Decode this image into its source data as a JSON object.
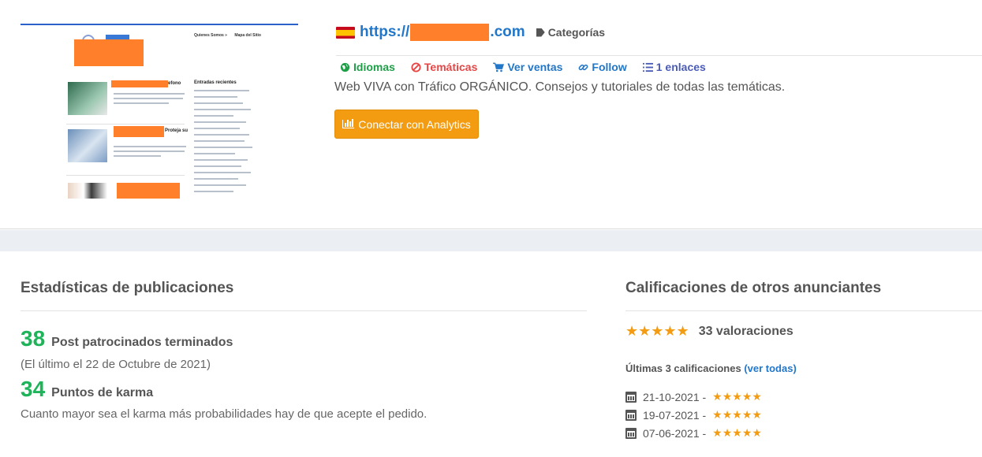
{
  "site": {
    "url_prefix": "https://",
    "url_suffix": ".com",
    "categories_label": "Categorías",
    "links": {
      "idiomas": "Idiomas",
      "tematicas": "Temáticas",
      "ventas": "Ver ventas",
      "follow": "Follow",
      "enlaces": "1 enlaces"
    },
    "description": "Web VIVA con Tráfico ORGÁNICO. Consejos y tutoriales de todas las temáticas.",
    "analytics_button": "Conectar con Analytics"
  },
  "preview": {
    "menu": [
      "Quienes Somos »",
      "Mapa del Sitio"
    ],
    "sidebar_title": "Entradas recientes",
    "post_fragment_1": "efono",
    "post_fragment_2": "Proteja su"
  },
  "stats": {
    "title": "Estadísticas de publicaciones",
    "posts_count": "38",
    "posts_label": "Post patrocinados terminados",
    "last_post": "(El último el 22 de Octubre de 2021)",
    "karma_count": "34",
    "karma_label": "Puntos de karma",
    "karma_note": "Cuanto mayor sea el karma más probabilidades hay de que acepte el pedido."
  },
  "ratings": {
    "title": "Calificaciones de otros anunciantes",
    "stars": "★★★★★",
    "count_label": "33 valoraciones",
    "last_label": "Últimas 3 calificaciones",
    "see_all": "(ver todas)",
    "reviews": [
      {
        "date": "21-10-2021 -",
        "stars": "★★★★★"
      },
      {
        "date": "19-07-2021 -",
        "stars": "★★★★★"
      },
      {
        "date": "07-06-2021 -",
        "stars": "★★★★★"
      }
    ]
  },
  "colors": {
    "link_blue": "#2277c9",
    "green": "#1fb35a",
    "red": "#e84545",
    "orange": "#f39c12",
    "redaction": "#ff7f2a"
  }
}
